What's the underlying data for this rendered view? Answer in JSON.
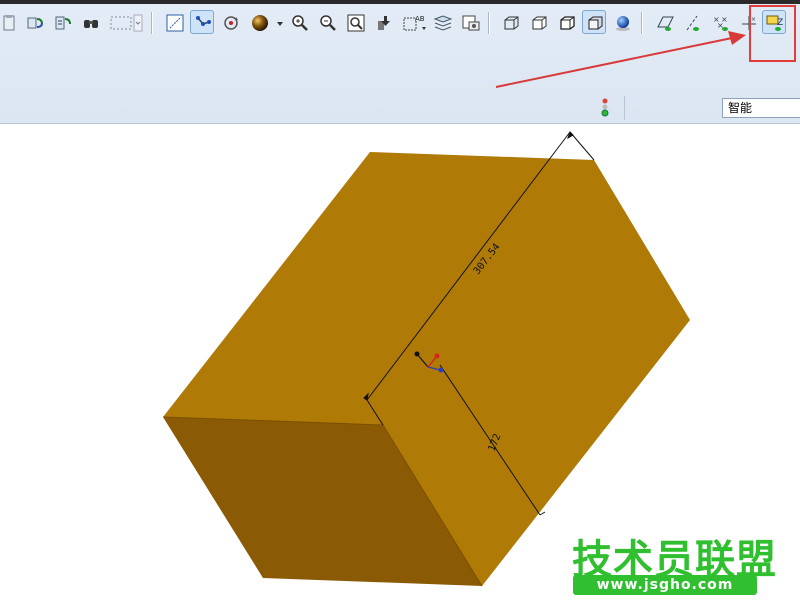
{
  "toolbar": {
    "icons": [
      "paste-icon",
      "regenerate-icon",
      "regenerate-manager-icon",
      "find-icon",
      "select-box-icon",
      "refit-icon",
      "datum-display-icon",
      "spin-center-icon",
      "appearance-icon",
      "zoom-in-icon",
      "zoom-out-icon",
      "refit-zoom-icon",
      "repaint-icon",
      "annotation-display-icon",
      "layers-icon",
      "saved-views-icon",
      "wireframe-icon",
      "hidden-line-icon",
      "no-hidden-icon",
      "shading-icon",
      "enhanced-realism-icon",
      "plane-display-icon",
      "axis-display-icon",
      "point-display-icon",
      "csys-display-icon",
      "annotation-toggle-icon"
    ],
    "highlighted_icon": "annotation-toggle-icon",
    "filter_value": "智能"
  },
  "model": {
    "dimension_length": "307.54",
    "dimension_height": "172",
    "color_top": "#b07a07",
    "color_front": "#8a5a05"
  },
  "watermark": {
    "title": "技术员联盟",
    "url": "www.jsgho.com"
  },
  "colors": {
    "accent_red": "#e23c3c",
    "watermark_green": "#2fbf2f"
  }
}
